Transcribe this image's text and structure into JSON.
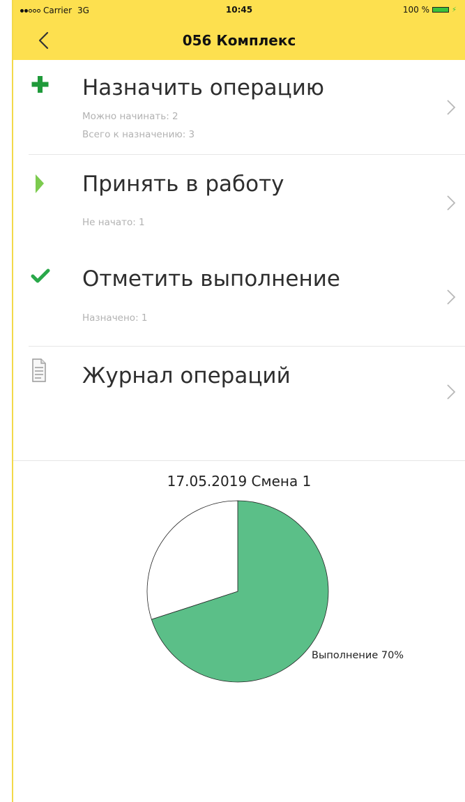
{
  "status_bar": {
    "carrier": "Carrier",
    "network": "3G",
    "time": "10:45",
    "battery": "100 %",
    "signal_bars_filled": 2,
    "signal_bars_total": 5
  },
  "nav": {
    "title": "056 Комплекс",
    "back_icon": "chevron-left-icon"
  },
  "menu": {
    "items": [
      {
        "title": "Назначить операцию",
        "icon": "plus-icon",
        "subs": [
          "Можно начинать: 2",
          "Всего к назначению: 3"
        ]
      },
      {
        "title": "Принять в работу",
        "icon": "play-icon",
        "subs": [
          "Не начато: 1"
        ]
      },
      {
        "title": "Отметить выполнение",
        "icon": "checkmark-icon",
        "subs": [
          "Назначено: 1"
        ]
      },
      {
        "title": "Журнал операций",
        "icon": "document-icon",
        "subs": []
      }
    ]
  },
  "colors": {
    "header": "#fde04f",
    "plus_icon": "#1f9a3a",
    "play_icon": "#7ccb4e",
    "check_icon": "#2aa84a",
    "pie_done": "#5bbf88",
    "pie_rest": "#ffffff"
  },
  "chart_data": {
    "type": "pie",
    "title": "17.05.2019 Смена 1",
    "slices": [
      {
        "label": "Выполнение 70%",
        "value": 70,
        "color": "#5bbf88"
      },
      {
        "label": "",
        "value": 30,
        "color": "#ffffff"
      }
    ]
  }
}
